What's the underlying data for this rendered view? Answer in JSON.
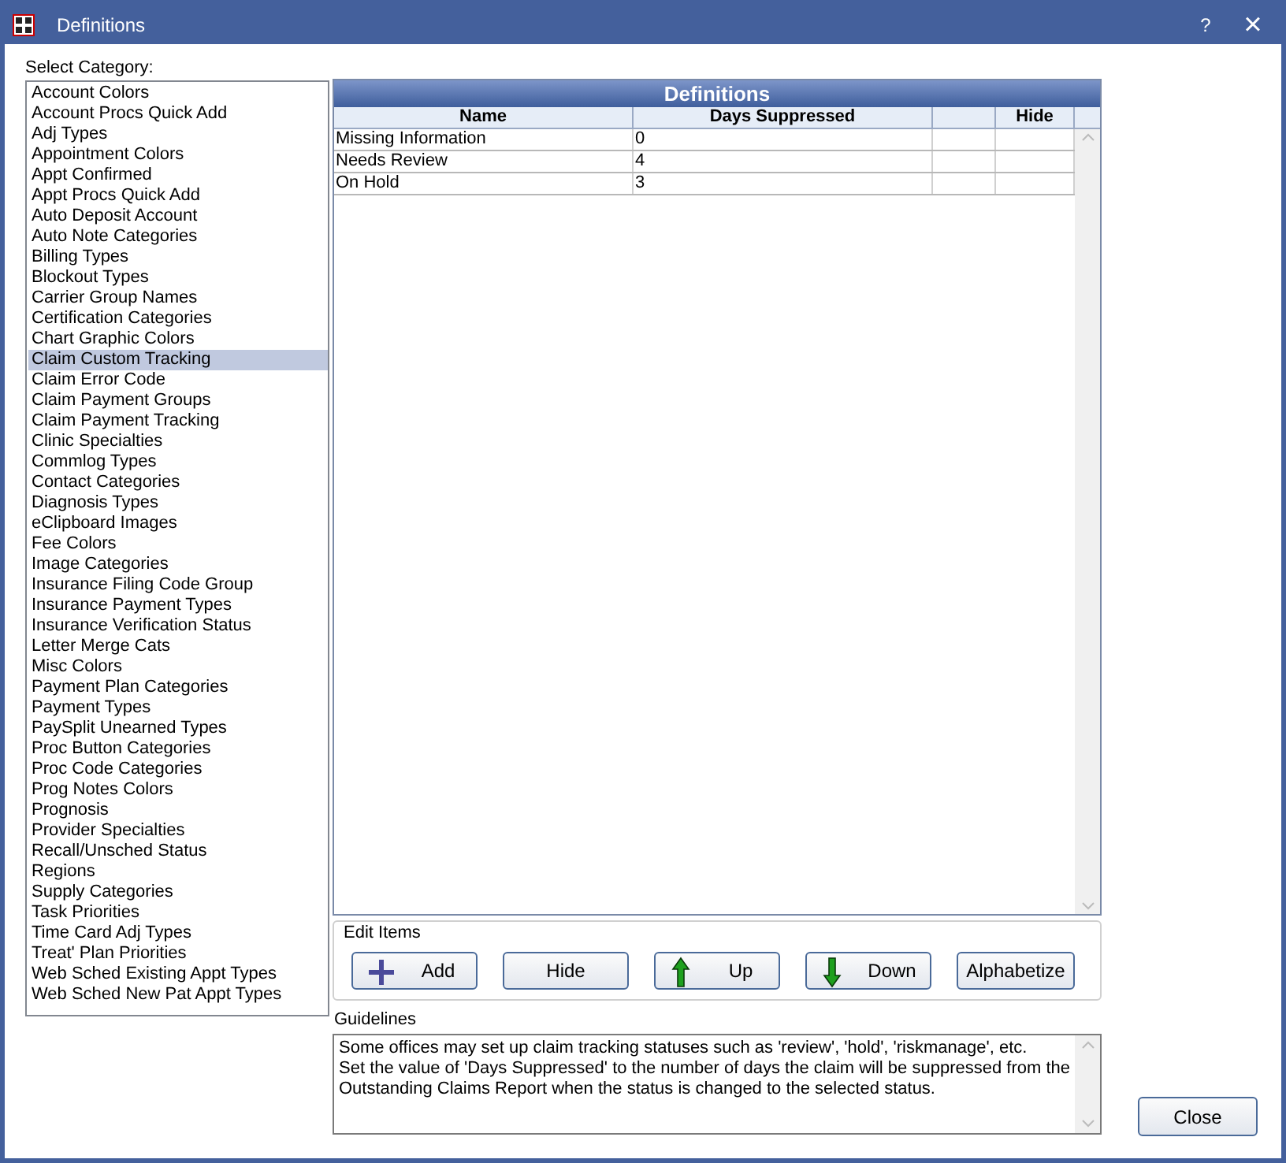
{
  "window": {
    "title": "Definitions",
    "help": "?",
    "close": "×"
  },
  "category_label": "Select Category:",
  "categories": [
    {
      "label": "Account Colors",
      "selected": false
    },
    {
      "label": "Account Procs Quick Add",
      "selected": false
    },
    {
      "label": "Adj Types",
      "selected": false
    },
    {
      "label": "Appointment Colors",
      "selected": false
    },
    {
      "label": "Appt Confirmed",
      "selected": false
    },
    {
      "label": "Appt Procs Quick Add",
      "selected": false
    },
    {
      "label": "Auto Deposit Account",
      "selected": false
    },
    {
      "label": "Auto Note Categories",
      "selected": false
    },
    {
      "label": "Billing Types",
      "selected": false
    },
    {
      "label": "Blockout Types",
      "selected": false
    },
    {
      "label": "Carrier Group Names",
      "selected": false
    },
    {
      "label": "Certification Categories",
      "selected": false
    },
    {
      "label": "Chart Graphic Colors",
      "selected": false
    },
    {
      "label": "Claim Custom Tracking",
      "selected": true
    },
    {
      "label": "Claim Error Code",
      "selected": false
    },
    {
      "label": "Claim Payment Groups",
      "selected": false
    },
    {
      "label": "Claim Payment Tracking",
      "selected": false
    },
    {
      "label": "Clinic Specialties",
      "selected": false
    },
    {
      "label": "Commlog Types",
      "selected": false
    },
    {
      "label": "Contact Categories",
      "selected": false
    },
    {
      "label": "Diagnosis Types",
      "selected": false
    },
    {
      "label": "eClipboard Images",
      "selected": false
    },
    {
      "label": "Fee Colors",
      "selected": false
    },
    {
      "label": "Image Categories",
      "selected": false
    },
    {
      "label": "Insurance Filing Code Group",
      "selected": false
    },
    {
      "label": "Insurance Payment Types",
      "selected": false
    },
    {
      "label": "Insurance Verification Status",
      "selected": false
    },
    {
      "label": "Letter Merge Cats",
      "selected": false
    },
    {
      "label": "Misc Colors",
      "selected": false
    },
    {
      "label": "Payment Plan Categories",
      "selected": false
    },
    {
      "label": "Payment Types",
      "selected": false
    },
    {
      "label": "PaySplit Unearned Types",
      "selected": false
    },
    {
      "label": "Proc Button Categories",
      "selected": false
    },
    {
      "label": "Proc Code Categories",
      "selected": false
    },
    {
      "label": "Prog Notes Colors",
      "selected": false
    },
    {
      "label": "Prognosis",
      "selected": false
    },
    {
      "label": "Provider Specialties",
      "selected": false
    },
    {
      "label": "Recall/Unsched Status",
      "selected": false
    },
    {
      "label": "Regions",
      "selected": false
    },
    {
      "label": "Supply Categories",
      "selected": false
    },
    {
      "label": "Task Priorities",
      "selected": false
    },
    {
      "label": "Time Card Adj Types",
      "selected": false
    },
    {
      "label": "Treat' Plan Priorities",
      "selected": false
    },
    {
      "label": "Web Sched Existing Appt Types",
      "selected": false
    },
    {
      "label": "Web Sched New Pat Appt Types",
      "selected": false
    }
  ],
  "grid": {
    "title": "Definitions",
    "columns": [
      "Name",
      "Days Suppressed",
      "Hide"
    ],
    "rows": [
      {
        "name": "Missing Information",
        "days_suppressed": "0"
      },
      {
        "name": "Needs Review",
        "days_suppressed": "4"
      },
      {
        "name": "On Hold",
        "days_suppressed": "3"
      }
    ]
  },
  "edit_items": {
    "label": "Edit Items",
    "buttons": [
      {
        "label": "Add",
        "kind": "add"
      },
      {
        "label": "Hide",
        "kind": "plain"
      },
      {
        "label": "Up",
        "kind": "up"
      },
      {
        "label": "Down",
        "kind": "down"
      },
      {
        "label": "Alphabetize",
        "kind": "plain"
      }
    ]
  },
  "guidelines": {
    "label": "Guidelines",
    "lines": [
      "Some offices may set up claim tracking statuses such as 'review', 'hold', 'riskmanage', etc.",
      "Set the value of 'Days Suppressed' to the number of days the claim will be suppressed from the",
      "Outstanding Claims Report when the status is changed to the selected status."
    ]
  },
  "close_button": "Close"
}
